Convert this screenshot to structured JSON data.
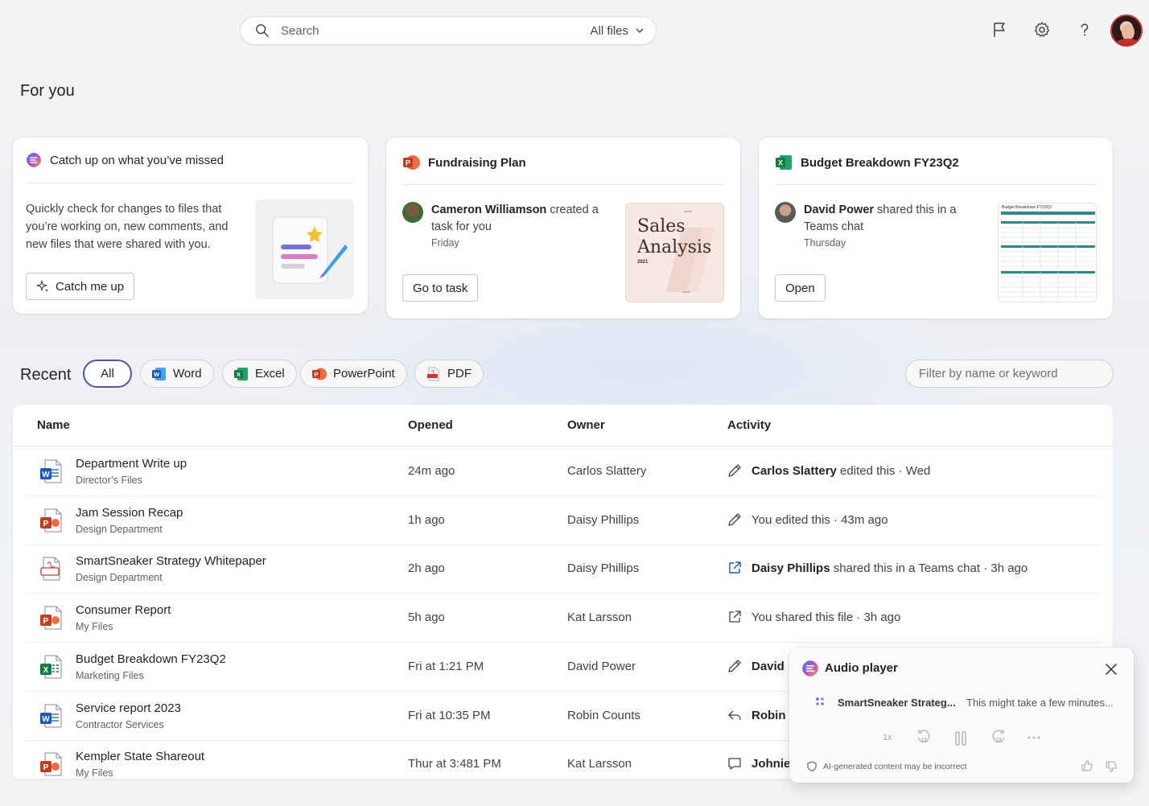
{
  "search": {
    "placeholder": "Search",
    "scope": "All files"
  },
  "section_for_you": "For you",
  "cards": [
    {
      "title": "Catch up on what you’ve missed",
      "body": "Quickly check for changes to files that you’re working on, new comments, and new files that were shared with you.",
      "button": "Catch me up"
    },
    {
      "title": "Fundraising Plan",
      "person": "Cameron Williamson",
      "action": " created a task for you",
      "when": "Friday",
      "button": "Go to task",
      "thumb_line1": "Sales",
      "thumb_line2": "Analysis",
      "thumb_year": "2021"
    },
    {
      "title": "Budget Breakdown FY23Q2",
      "person": "David Power",
      "action": " shared this in a Teams chat",
      "when": "Thursday",
      "button": "Open",
      "thumb_header": "Budget Breakdown FY23Q2"
    }
  ],
  "recent": {
    "title": "Recent",
    "chips": [
      "All",
      "Word",
      "Excel",
      "PowerPoint",
      "PDF"
    ],
    "filter_placeholder": "Filter by name or keyword",
    "columns": [
      "Name",
      "Opened",
      "Owner",
      "Activity"
    ],
    "rows": [
      {
        "type": "word",
        "name": "Department Write up",
        "location": "Director’s Files",
        "opened": "24m ago",
        "owner": "Carlos Slattery",
        "activity_icon": "pencil-icon",
        "activity_person": "Carlos Slattery",
        "activity_text": " edited this · Wed"
      },
      {
        "type": "ppt",
        "name": "Jam Session Recap",
        "location": "Design Department",
        "opened": "1h ago",
        "owner": "Daisy Phillips",
        "activity_icon": "pencil-icon",
        "activity_person": "",
        "activity_text": "You edited this · 43m ago"
      },
      {
        "type": "pdf",
        "name": "SmartSneaker Strategy Whitepaper",
        "location": "Design Department",
        "opened": "2h ago",
        "owner": "Daisy Phillips",
        "activity_icon": "share-icon",
        "activity_person": "Daisy Phillips",
        "activity_text": " shared this in a Teams chat · 3h ago"
      },
      {
        "type": "ppt",
        "name": "Consumer Report",
        "location": "My Files",
        "opened": "5h ago",
        "owner": "Kat Larsson",
        "activity_icon": "share-out-icon",
        "activity_person": "",
        "activity_text": "You shared this file · 3h ago"
      },
      {
        "type": "excel",
        "name": "Budget Breakdown FY23Q2",
        "location": "Marketing Files",
        "opened": "Fri at 1:21 PM",
        "owner": "David Power",
        "activity_icon": "pencil-icon",
        "activity_person": "David",
        "activity_text": ""
      },
      {
        "type": "word",
        "name": "Service report 2023",
        "location": "Contractor Services",
        "opened": "Fri at 10:35 PM",
        "owner": "Robin Counts",
        "activity_icon": "reply-icon",
        "activity_person": "Robin",
        "activity_text": ""
      },
      {
        "type": "ppt",
        "name": "Kempler State Shareout",
        "location": "My Files",
        "opened": "Thur at 3:481 PM",
        "owner": "Kat Larsson",
        "activity_icon": "comment-icon",
        "activity_person": "Johnie",
        "activity_text": ""
      }
    ]
  },
  "audio_player": {
    "title": "Audio player",
    "track": "SmartSneaker Strateg...",
    "status": "This might take a few minutes...",
    "speed": "1x",
    "skip_back": "15",
    "skip_forward": "15",
    "disclaimer": "AI-generated content may be incorrect"
  },
  "colors": {
    "word": "#185abd",
    "excel": "#107c41",
    "ppt": "#c43e1c",
    "pdf": "#d13438",
    "accent": "#4f52b2"
  }
}
